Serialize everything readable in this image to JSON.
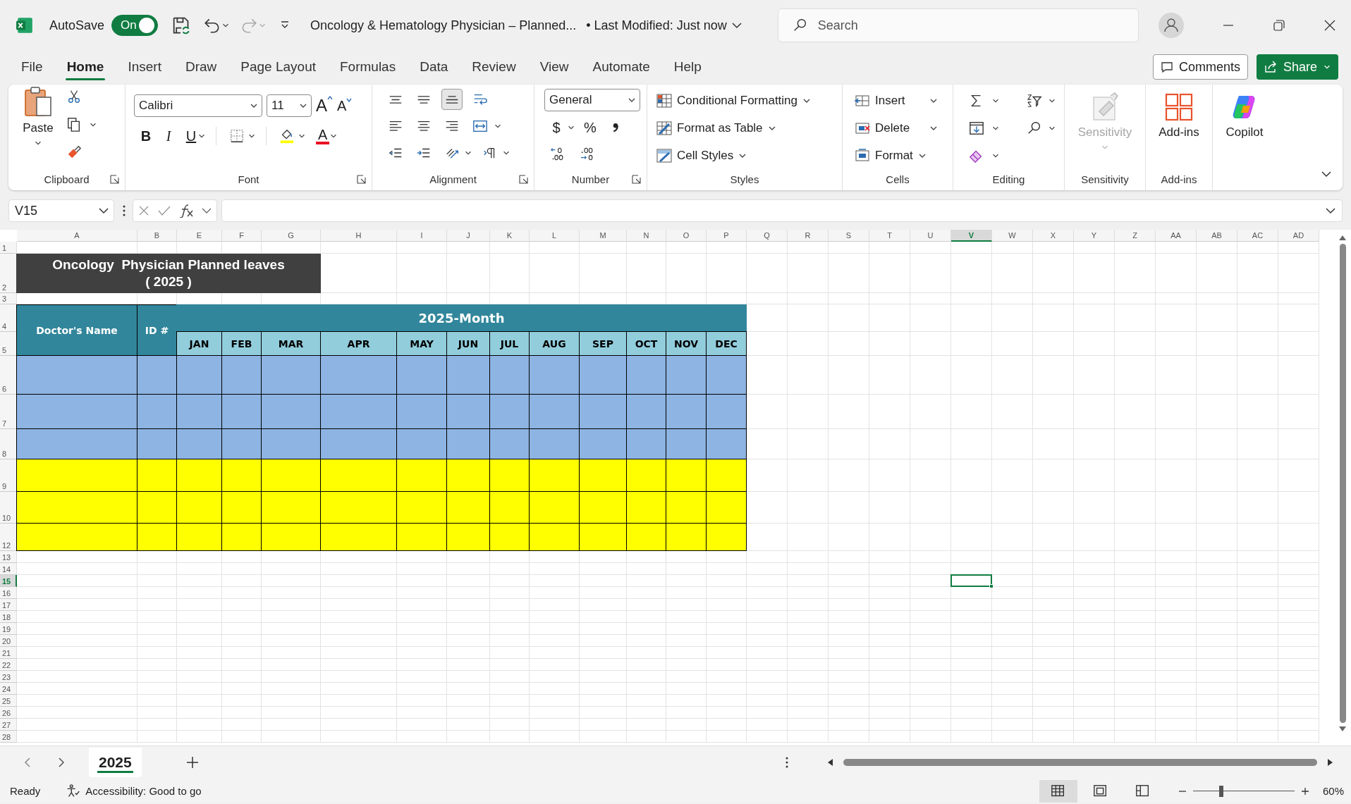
{
  "title_bar": {
    "autosave_label": "AutoSave",
    "autosave_on": true,
    "toggle_text": "On",
    "document_title": "Oncology & Hematology Physician – Planned...",
    "modified": "• Last Modified: Just now",
    "search_placeholder": "Search"
  },
  "menu_tabs": [
    {
      "label": "File",
      "selected": false
    },
    {
      "label": "Home",
      "selected": true
    },
    {
      "label": "Insert",
      "selected": false
    },
    {
      "label": "Draw",
      "selected": false
    },
    {
      "label": "Page Layout",
      "selected": false
    },
    {
      "label": "Formulas",
      "selected": false
    },
    {
      "label": "Data",
      "selected": false
    },
    {
      "label": "Review",
      "selected": false
    },
    {
      "label": "View",
      "selected": false
    },
    {
      "label": "Automate",
      "selected": false
    },
    {
      "label": "Help",
      "selected": false
    }
  ],
  "comments_button": "Comments",
  "share_button": "Share",
  "ribbon": {
    "clipboard": {
      "paste": "Paste",
      "label": "Clipboard"
    },
    "font": {
      "font_name": "Calibri",
      "font_size": "11",
      "grow": "A",
      "shrink": "A",
      "bold": "B",
      "italic": "I",
      "underline": "U",
      "font_color": "A",
      "label": "Font"
    },
    "alignment": {
      "vertical": [
        {
          "selected": false
        },
        {
          "selected": false
        },
        {
          "selected": true
        }
      ],
      "label": "Alignment"
    },
    "number": {
      "format": "General",
      "currency": "$",
      "percent": "%",
      "label": "Number"
    },
    "styles": {
      "items": [
        "Conditional Formatting",
        "Format as Table",
        "Cell Styles"
      ],
      "label": "Styles"
    },
    "cells": {
      "items": [
        "Insert",
        "Delete",
        "Format"
      ],
      "label": "Cells"
    },
    "editing": {
      "label": "Editing"
    },
    "sensitivity": {
      "button": "Sensitivity",
      "disabled": true,
      "label": "Sensitivity"
    },
    "addins": {
      "button": "Add-ins",
      "label": "Add-ins"
    },
    "copilot": {
      "button": "Copilot"
    }
  },
  "formula_bar": {
    "name_box": "V15"
  },
  "sheet": {
    "columns": [
      {
        "label": "A",
        "selected": false
      },
      {
        "label": "B",
        "selected": false
      },
      {
        "label": "E",
        "selected": false
      },
      {
        "label": "F",
        "selected": false
      },
      {
        "label": "G",
        "selected": false
      },
      {
        "label": "H",
        "selected": false
      },
      {
        "label": "I",
        "selected": false
      },
      {
        "label": "J",
        "selected": false
      },
      {
        "label": "K",
        "selected": false
      },
      {
        "label": "L",
        "selected": false
      },
      {
        "label": "M",
        "selected": false
      },
      {
        "label": "N",
        "selected": false
      },
      {
        "label": "O",
        "selected": false
      },
      {
        "label": "P",
        "selected": false
      },
      {
        "label": "Q",
        "selected": false
      },
      {
        "label": "R",
        "selected": false
      },
      {
        "label": "S",
        "selected": false
      },
      {
        "label": "T",
        "selected": false
      },
      {
        "label": "U",
        "selected": false
      },
      {
        "label": "V",
        "selected": true
      },
      {
        "label": "W",
        "selected": false
      },
      {
        "label": "X",
        "selected": false
      },
      {
        "label": "Y",
        "selected": false
      },
      {
        "label": "Z",
        "selected": false
      },
      {
        "label": "AA",
        "selected": false
      },
      {
        "label": "AB",
        "selected": false
      },
      {
        "label": "AC",
        "selected": false
      },
      {
        "label": "AD",
        "selected": false
      }
    ],
    "rows": [
      {
        "label": "1",
        "selected": false
      },
      {
        "label": "2",
        "selected": false
      },
      {
        "label": "3",
        "selected": false
      },
      {
        "label": "4",
        "selected": false
      },
      {
        "label": "5",
        "selected": false
      },
      {
        "label": "6",
        "selected": false
      },
      {
        "label": "7",
        "selected": false
      },
      {
        "label": "8",
        "selected": false
      },
      {
        "label": "9",
        "selected": false
      },
      {
        "label": "10",
        "selected": false
      },
      {
        "label": "12",
        "selected": false
      },
      {
        "label": "13",
        "selected": false
      },
      {
        "label": "14",
        "selected": false
      },
      {
        "label": "15",
        "selected": true
      },
      {
        "label": "16",
        "selected": false
      },
      {
        "label": "17",
        "selected": false
      },
      {
        "label": "18",
        "selected": false
      },
      {
        "label": "19",
        "selected": false
      },
      {
        "label": "20",
        "selected": false
      },
      {
        "label": "21",
        "selected": false
      },
      {
        "label": "22",
        "selected": false
      },
      {
        "label": "23",
        "selected": false
      },
      {
        "label": "24",
        "selected": false
      },
      {
        "label": "25",
        "selected": false
      },
      {
        "label": "26",
        "selected": false
      },
      {
        "label": "27",
        "selected": false
      },
      {
        "label": "28",
        "selected": false
      }
    ],
    "title": "Oncology  Physician Planned leaves\n( 2025 )",
    "name_header": "Doctor's Name",
    "id_header": "ID #",
    "month_group": "2025-Month",
    "months": [
      "JAN",
      "FEB",
      "MAR",
      "APR",
      "MAY",
      "JUN",
      "JUL",
      "AUG",
      "SEP",
      "OCT",
      "NOV",
      "DEC"
    ],
    "data_rows": [
      {
        "color": "#8db4e2"
      },
      {
        "color": "#8db4e2"
      },
      {
        "color": "#8db4e2"
      },
      {
        "color": "#ffff00"
      },
      {
        "color": "#ffff00"
      },
      {
        "color": "#ffff00"
      }
    ]
  },
  "sheet_tabs": [
    {
      "label": "2025",
      "selected": true
    }
  ],
  "status_bar": {
    "ready": "Ready",
    "accessibility": "Accessibility: Good to go",
    "views": [
      {
        "kind": "normal",
        "selected": true
      },
      {
        "kind": "page_layout",
        "selected": false
      },
      {
        "kind": "page_break",
        "selected": false
      }
    ],
    "zoom_level": {
      "level": 0.28
    },
    "zoom": "60%"
  }
}
